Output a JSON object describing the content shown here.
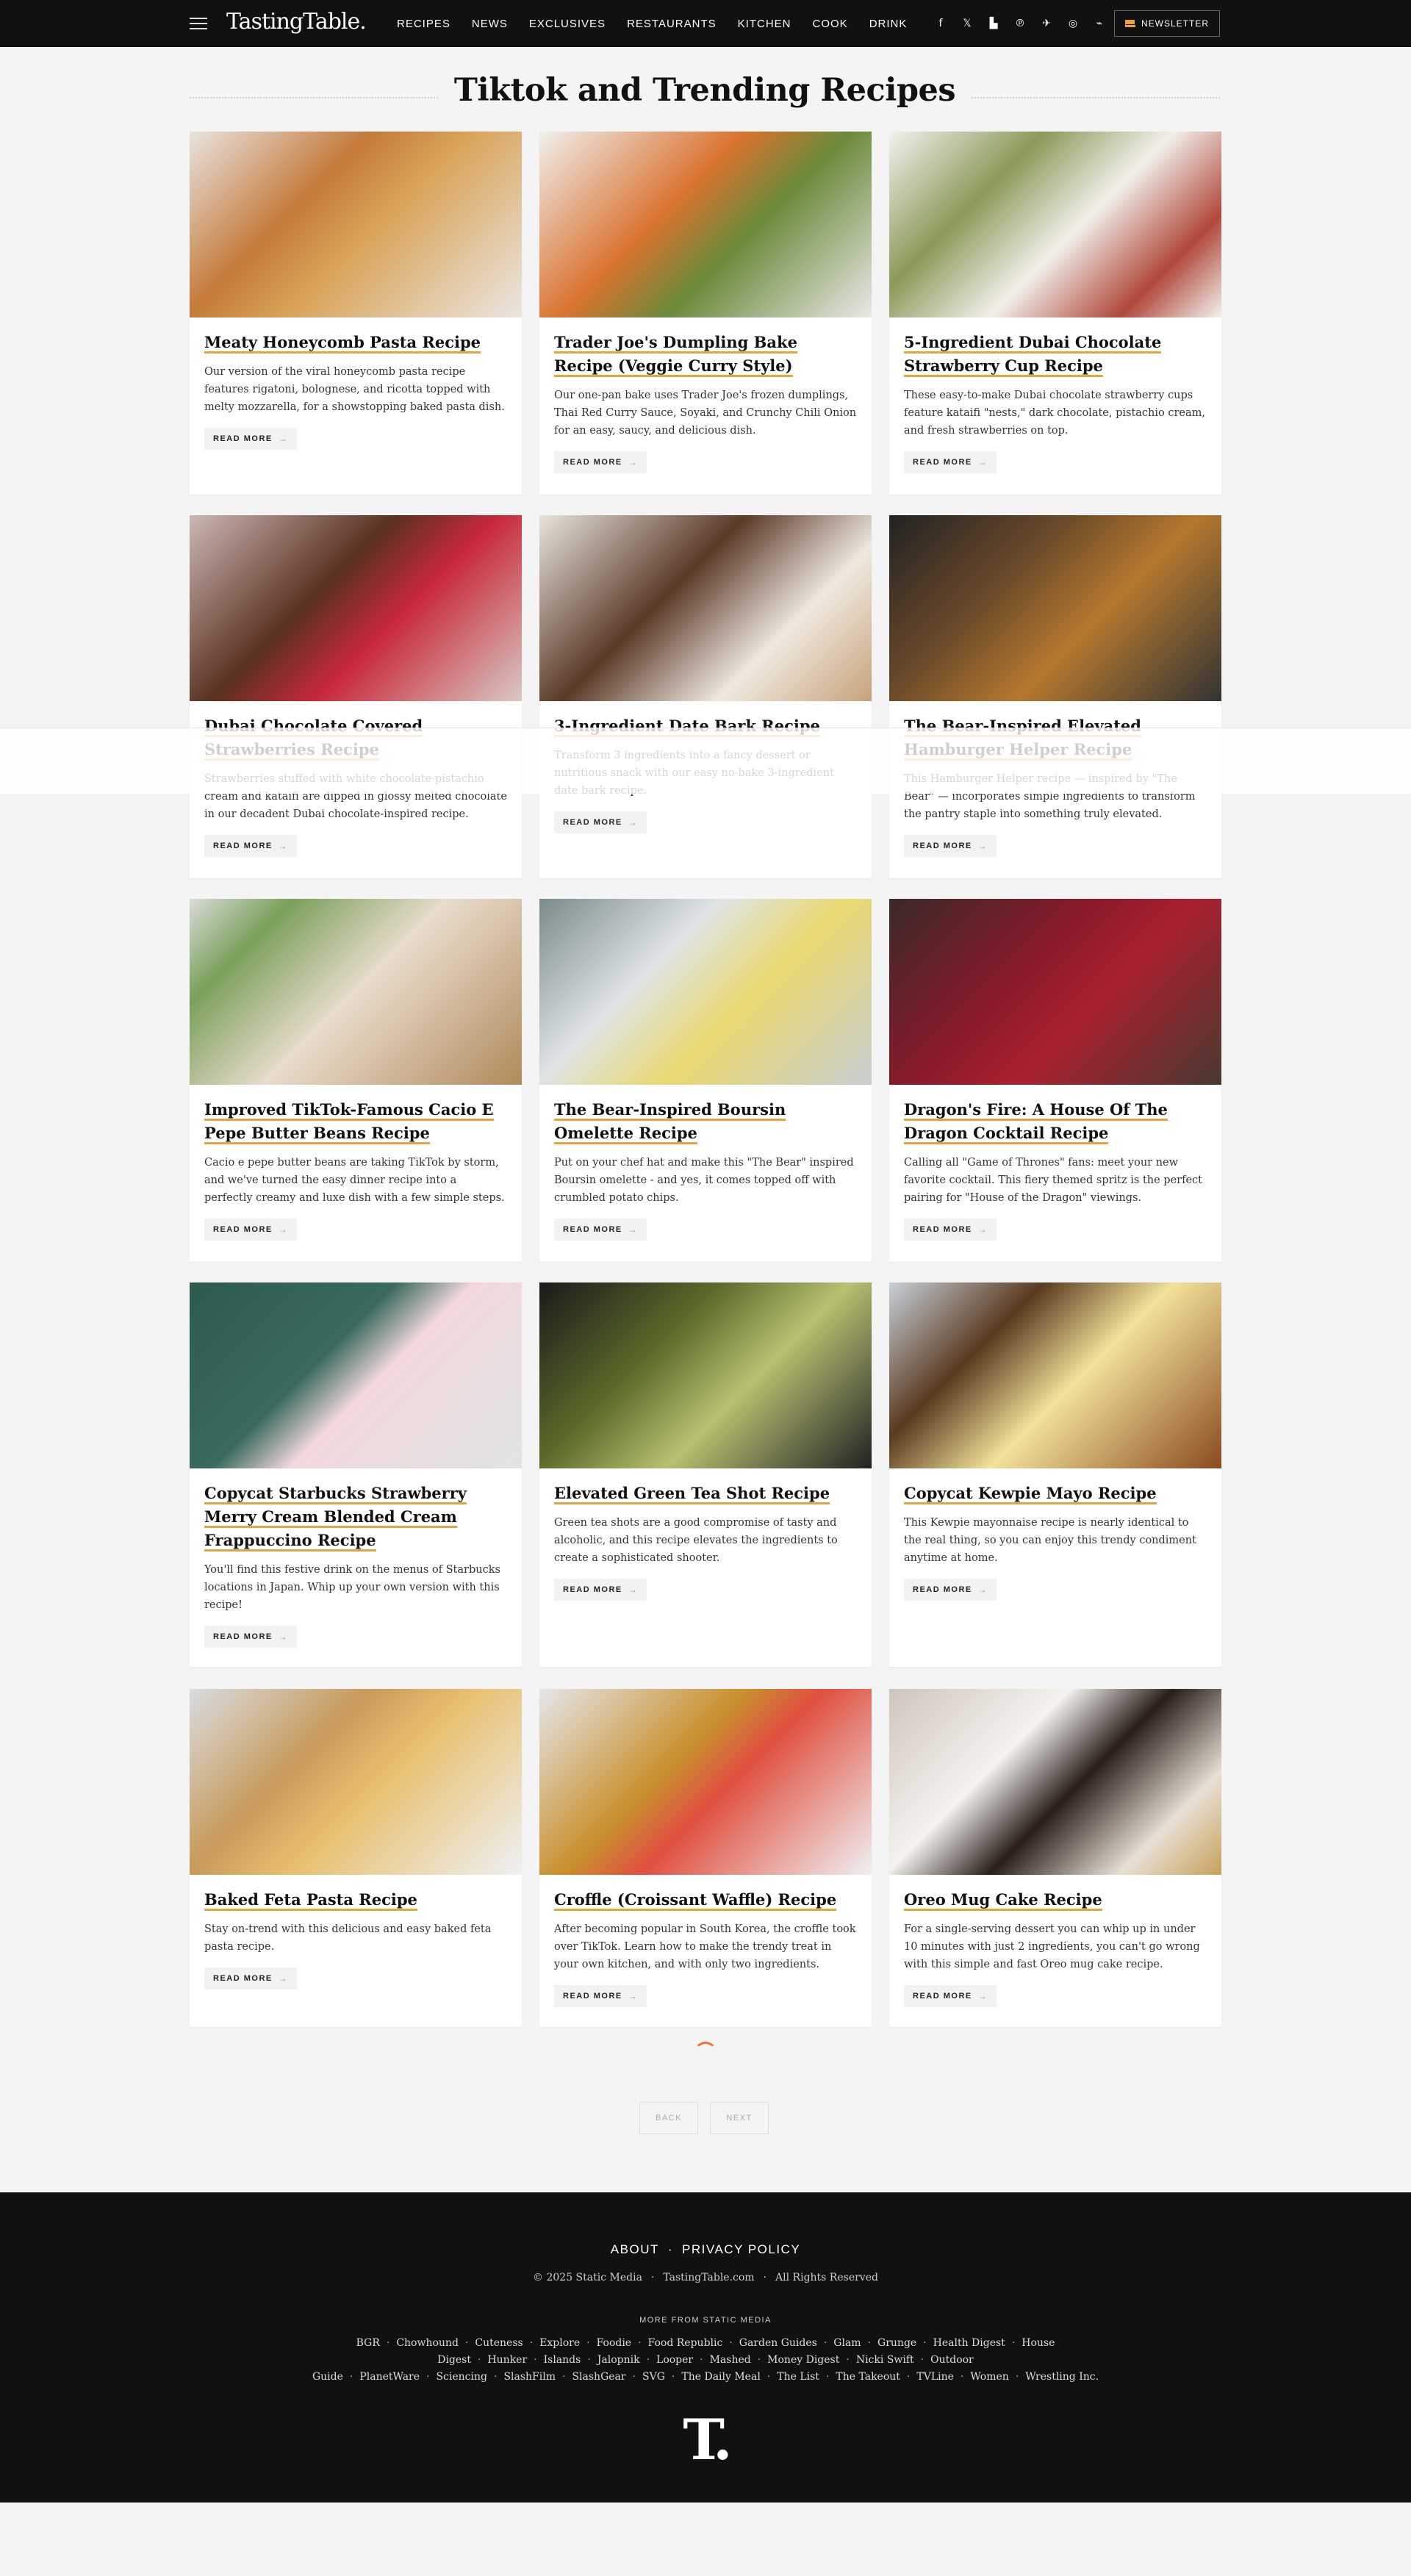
{
  "header": {
    "logo": "TastingTable.",
    "nav": [
      "RECIPES",
      "NEWS",
      "EXCLUSIVES",
      "RESTAURANTS",
      "KITCHEN",
      "COOK",
      "DRINK"
    ],
    "social_icons": [
      "facebook-icon",
      "x-icon",
      "flipboard-icon",
      "pinterest-icon",
      "bluesky-icon",
      "instagram-icon",
      "rss-icon"
    ],
    "social_glyphs": [
      "f",
      "𝕏",
      "▙",
      "℗",
      "✈",
      "◎",
      "⌁"
    ],
    "newsletter": "NEWSLETTER"
  },
  "page_title": "Tiktok and Trending Recipes",
  "read_more": "READ MORE",
  "cards": [
    {
      "title": "Meaty Honeycomb Pasta Recipe",
      "desc": "Our version of the viral honeycomb pasta recipe features rigatoni, bolognese, and ricotta topped with melty mozzarella, for a showstopping baked pasta dish."
    },
    {
      "title": "Trader Joe's Dumpling Bake Recipe (Veggie Curry Style)",
      "desc": "Our one-pan bake uses Trader Joe's frozen dumplings, Thai Red Curry Sauce, Soyaki, and Crunchy Chili Onion for an easy, saucy, and delicious dish."
    },
    {
      "title": "5-Ingredient Dubai Chocolate Strawberry Cup Recipe",
      "desc": "These easy-to-make Dubai chocolate strawberry cups feature kataifi \"nests,\" dark chocolate, pistachio cream, and fresh strawberries on top."
    },
    {
      "title": "Dubai Chocolate Covered Strawberries Recipe",
      "desc": "Strawberries stuffed with white chocolate-pistachio cream and kataifi are dipped in glossy melted chocolate in our decadent Dubai chocolate-inspired recipe."
    },
    {
      "title": "3-Ingredient Date Bark Recipe",
      "desc": "Transform 3 ingredients into a fancy dessert or nutritious snack with our easy no-bake 3-ingredient date bark recipe."
    },
    {
      "title": "The Bear-Inspired Elevated Hamburger Helper Recipe",
      "desc": "This Hamburger Helper recipe — inspired by \"The Bear\" — incorporates simple ingredients to transform the pantry staple into something truly elevated."
    },
    {
      "title": "Improved TikTok-Famous Cacio E Pepe Butter Beans Recipe",
      "desc": "Cacio e pepe butter beans are taking TikTok by storm, and we've turned the easy dinner recipe into a perfectly creamy and luxe dish with a few simple steps."
    },
    {
      "title": "The Bear-Inspired Boursin Omelette Recipe",
      "desc": "Put on your chef hat and make this \"The Bear\" inspired Boursin omelette - and yes, it comes topped off with crumbled potato chips."
    },
    {
      "title": "Dragon's Fire: A House Of The Dragon Cocktail Recipe",
      "desc": "Calling all \"Game of Thrones\" fans: meet your new favorite cocktail. This fiery themed spritz is the perfect pairing for \"House of the Dragon\" viewings."
    },
    {
      "title": "Copycat Starbucks Strawberry Merry Cream Blended Cream Frappuccino Recipe",
      "desc": "You'll find this festive drink on the menus of Starbucks locations in Japan. Whip up your own version with this recipe!"
    },
    {
      "title": "Elevated Green Tea Shot Recipe",
      "desc": "Green tea shots are a good compromise of tasty and alcoholic, and this recipe elevates the ingredients to create a sophisticated shooter."
    },
    {
      "title": "Copycat Kewpie Mayo Recipe",
      "desc": "This Kewpie mayonnaise recipe is nearly identical to the real thing, so you can enjoy this trendy condiment anytime at home."
    },
    {
      "title": "Baked Feta Pasta Recipe",
      "desc": "Stay on-trend with this delicious and easy baked feta pasta recipe."
    },
    {
      "title": "Croffle (Croissant Waffle) Recipe",
      "desc": "After becoming popular in South Korea, the croffle took over TikTok. Learn how to make the trendy treat in your own kitchen, and with only two ingredients."
    },
    {
      "title": "Oreo Mug Cake Recipe",
      "desc": "For a single-serving dessert you can whip up in under 10 minutes with just 2 ingredients, you can't go wrong with this simple and fast Oreo mug cake recipe."
    }
  ],
  "pager": {
    "back": "BACK",
    "next": "NEXT"
  },
  "footer": {
    "about": "ABOUT",
    "privacy": "PRIVACY POLICY",
    "copyright": "© 2025 Static Media",
    "domain": "TastingTable.com",
    "rights": "All Rights Reserved",
    "more_heading": "MORE FROM STATIC MEDIA",
    "sites": [
      "BGR",
      "Chowhound",
      "Cuteness",
      "Explore",
      "Foodie",
      "Food Republic",
      "Garden Guides",
      "Glam",
      "Grunge",
      "Health Digest",
      "House Digest",
      "Hunker",
      "Islands",
      "Jalopnik",
      "Looper",
      "Mashed",
      "Money Digest",
      "Nicki Swift",
      "Outdoor Guide",
      "PlanetWare",
      "Sciencing",
      "SlashFilm",
      "SlashGear",
      "SVG",
      "The Daily Meal",
      "The List",
      "The Takeout",
      "TVLine",
      "Women",
      "Wrestling Inc."
    ],
    "logo": "T."
  },
  "colors": {
    "accent": "#e8a33a",
    "header_bg": "#111111",
    "spinner": "#e8783a"
  }
}
